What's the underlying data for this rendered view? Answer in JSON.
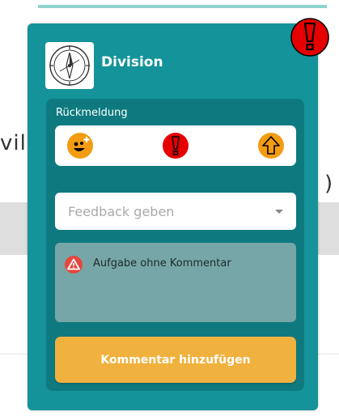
{
  "background": {
    "fragment_left": "vil",
    "fragment_right": ")"
  },
  "card": {
    "title": "Division",
    "logo_icon": "compass-icon",
    "alert_icon": "exclamation-icon",
    "feedback": {
      "label": "Rückmeldung",
      "reactions": [
        {
          "name": "smiley-add-icon",
          "color": "#f39c12"
        },
        {
          "name": "exclamation-icon",
          "color": "#e60000"
        },
        {
          "name": "arrow-up-icon",
          "color": "#f39c12"
        }
      ]
    },
    "select": {
      "placeholder": "Feedback geben"
    },
    "comment": {
      "icon": "warning-icon",
      "text": "Aufgabe ohne Kommentar"
    },
    "button_label": "Kommentar hinzufügen"
  },
  "colors": {
    "card": "#15939a",
    "panel": "#0e7a80",
    "button": "#f0b13e",
    "alert": "#e60000",
    "reaction_orange": "#f39c12"
  }
}
